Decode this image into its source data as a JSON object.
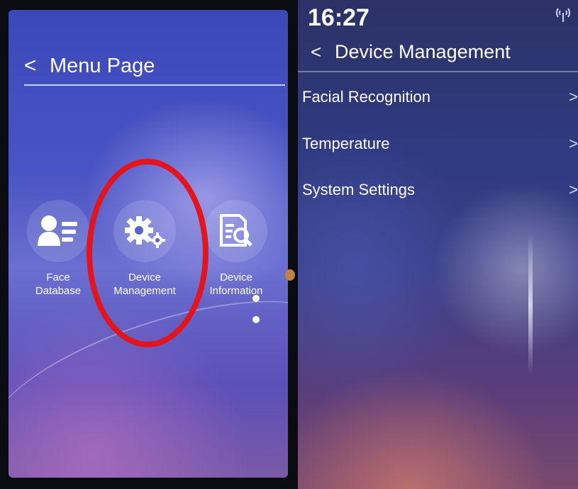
{
  "left_screen": {
    "header": {
      "back_glyph": "<",
      "title": "Menu Page"
    },
    "apps": [
      {
        "line1": "Face",
        "line2": "Database",
        "icon": "face-database-icon"
      },
      {
        "line1": "Device",
        "line2": "Management",
        "icon": "gear-icon"
      },
      {
        "line1": "Device",
        "line2": "Information",
        "icon": "document-search-icon"
      }
    ],
    "highlight_color": "#e4141c"
  },
  "right_screen": {
    "status": {
      "time": "16:27",
      "signal_icon": "signal-icon"
    },
    "header": {
      "back_glyph": "<",
      "title": "Device Management"
    },
    "menu": [
      {
        "label": "Facial Recognition",
        "chevron": ">"
      },
      {
        "label": "Temperature",
        "chevron": ">"
      },
      {
        "label": "System Settings",
        "chevron": ">"
      }
    ]
  }
}
